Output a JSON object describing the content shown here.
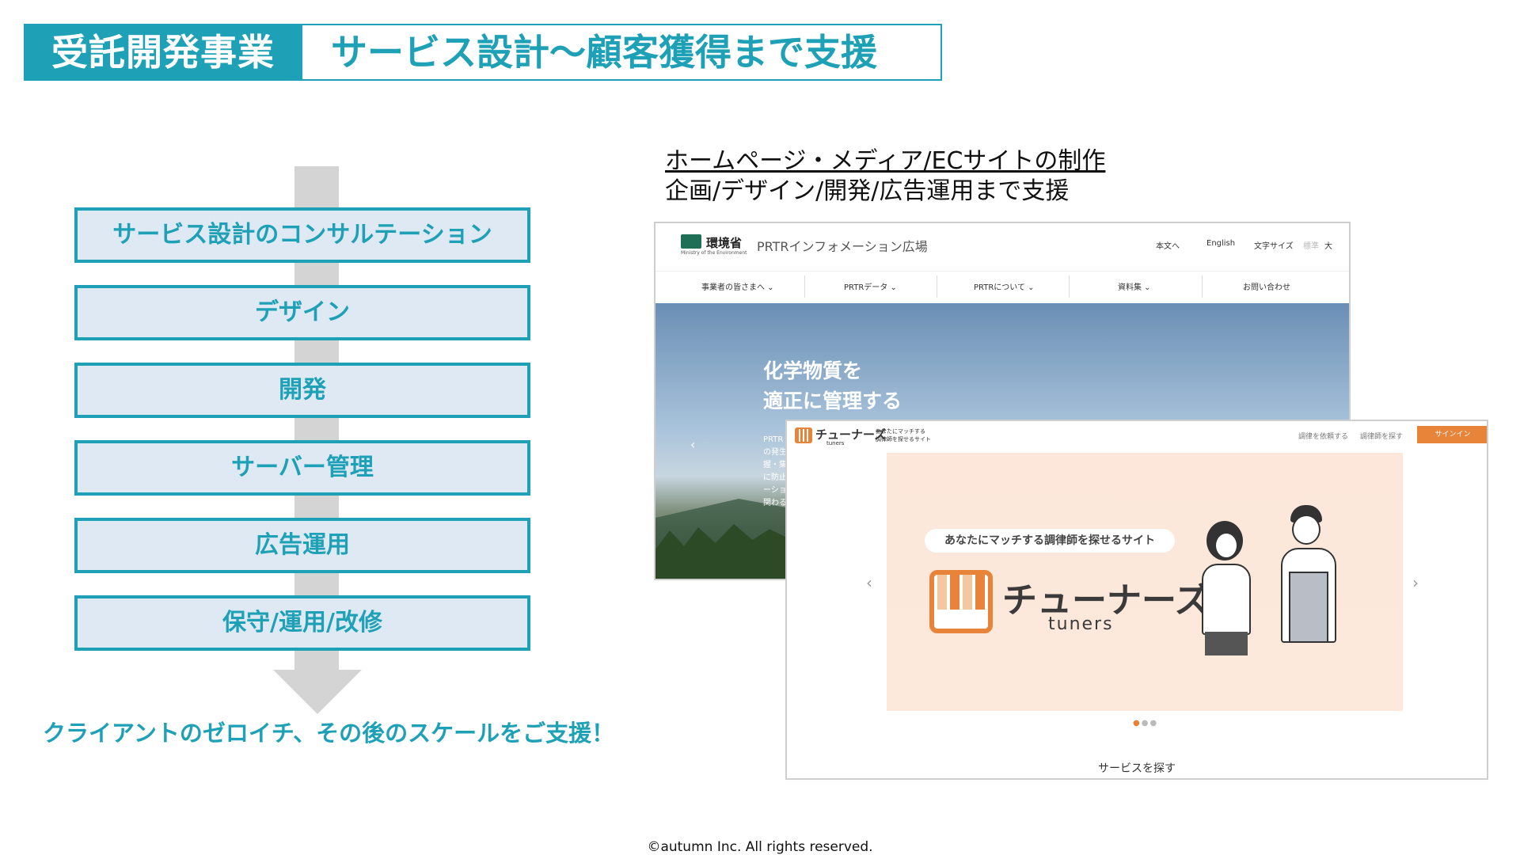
{
  "header": {
    "tag": "受託開発事業",
    "title": "サービス設計～顧客獲得まで支援"
  },
  "flow": {
    "steps": [
      "サービス設計のコンサルテーション",
      "デザイン",
      "開発",
      "サーバー管理",
      "広告運用",
      "保守/運用/改修"
    ],
    "tagline": "クライアントのゼロイチ、その後のスケールをご支援！"
  },
  "right": {
    "heading_line1": "ホームページ・メディア/ECサイトの制作",
    "heading_line2": "企画/デザイン/開発/広告運用まで支援"
  },
  "shot1": {
    "logo": "環境省",
    "logo_sub": "Ministry of the Environment",
    "site": "PRTRインフォメーション広場",
    "util": [
      "本文へ",
      "English",
      "文字サイズ",
      "標準",
      "大"
    ],
    "nav": [
      "事業者の皆さまへ ⌄",
      "PRTRデータ ⌄",
      "PRTRについて ⌄",
      "資料集 ⌄",
      "お問い合わせ"
    ],
    "hero_line1": "化学物質を",
    "hero_line2": "適正に管理する",
    "hero_small": "PRTR\nの発生\n握・集\nに防止\nーショ\n関わる"
  },
  "shot2": {
    "logo": "チューナーズ",
    "logo_sub": "tuners",
    "tag_line1": "あなたにマッチする",
    "tag_line2": "調律師を探せるサイト",
    "link1": "調律を依頼する",
    "link2": "調律師を探す",
    "signin": "サインイン",
    "pill": "あなたにマッチする調律師を探せるサイト",
    "brand": "チューナーズ",
    "brand_sub": "tuners",
    "find": "サービスを探す"
  },
  "footer": "©autumn Inc. All rights reserved.",
  "colors": {
    "accent": "#1ea1b6",
    "step_bg": "#dfe9f4",
    "arrow": "#d4d4d4",
    "tuners_orange": "#e8843a"
  }
}
